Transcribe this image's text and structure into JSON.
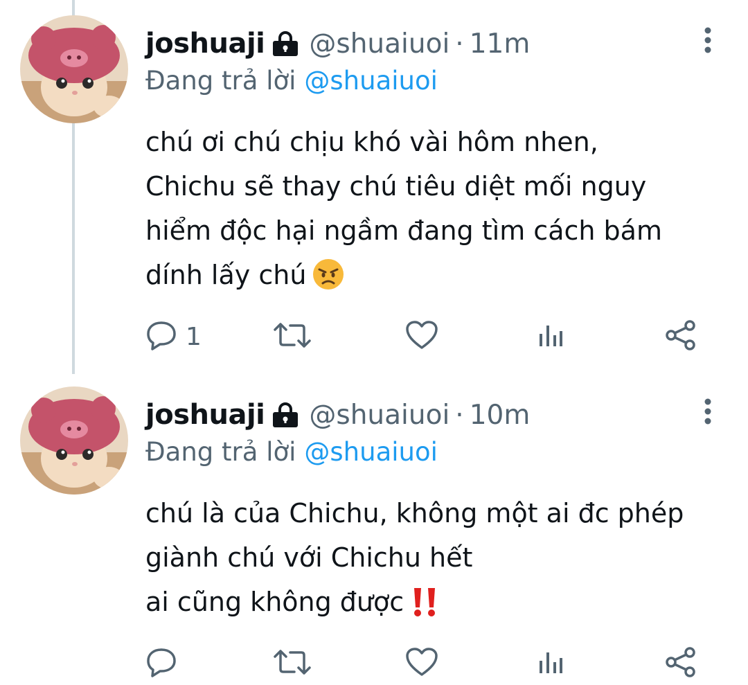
{
  "tweets": [
    {
      "display_name": "joshuaji",
      "handle": "@shuaiuoi",
      "separator": "·",
      "time": "11m",
      "reply_prefix": "Đang trả lời",
      "reply_to": "@shuaiuoi",
      "lines": [
        "chú ơi chú chịu khó vài hôm nhen,",
        "Chichu sẽ thay chú tiêu diệt mối nguy",
        "hiểm độc hại ngầm đang tìm cách bám",
        "dính lấy chú"
      ],
      "end_emoji": "angry-face-emoji",
      "actions": {
        "reply_count": "1",
        "retweet_count": "",
        "like_count": "",
        "views_count": ""
      }
    },
    {
      "display_name": "joshuaji",
      "handle": "@shuaiuoi",
      "separator": "·",
      "time": "10m",
      "reply_prefix": "Đang trả lời",
      "reply_to": "@shuaiuoi",
      "lines": [
        "chú là của Chichu, không một ai đc phép",
        "giành chú với Chichu hết",
        "ai cũng không được"
      ],
      "end_emoji": "double-exclamation-emoji",
      "actions": {
        "reply_count": "",
        "retweet_count": "",
        "like_count": "",
        "views_count": ""
      }
    }
  ],
  "icons": {
    "lock": "lock-icon",
    "more": "more-vertical-icon",
    "reply": "reply-icon",
    "retweet": "retweet-icon",
    "like": "heart-icon",
    "views": "views-icon",
    "share": "share-icon"
  },
  "colors": {
    "text": "#0f1419",
    "secondary": "#536471",
    "link": "#1d9bf0",
    "thread_line": "#cfd9de",
    "exclamation": "#e0201e"
  }
}
